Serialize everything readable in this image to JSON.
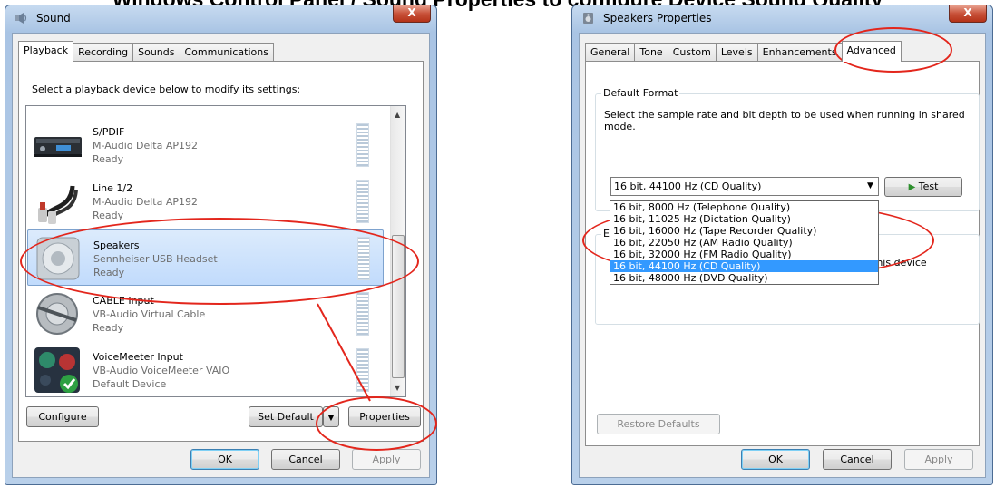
{
  "heading": "Windows Control Panel / Sound Properties to configure Device Sound Quality",
  "sound": {
    "title": "Sound",
    "close_label": "X",
    "tabs": [
      "Playback",
      "Recording",
      "Sounds",
      "Communications"
    ],
    "instruction": "Select a playback device below to modify its settings:",
    "devices": [
      {
        "name": "S/PDIF",
        "desc": "M-Audio Delta AP192",
        "status": "Ready"
      },
      {
        "name": "Line 1/2",
        "desc": "M-Audio Delta AP192",
        "status": "Ready"
      },
      {
        "name": "Speakers",
        "desc": "Sennheiser USB Headset",
        "status": "Ready"
      },
      {
        "name": "CABLE Input",
        "desc": "VB-Audio Virtual Cable",
        "status": "Ready"
      },
      {
        "name": "VoiceMeeter Input",
        "desc": "VB-Audio VoiceMeeter VAIO",
        "status": "Default Device"
      }
    ],
    "configure_label": "Configure",
    "set_default_label": "Set Default",
    "properties_label": "Properties",
    "ok_label": "OK",
    "cancel_label": "Cancel",
    "apply_label": "Apply"
  },
  "speakers": {
    "title": "Speakers Properties",
    "close_label": "X",
    "tabs": [
      "General",
      "Tone",
      "Custom",
      "Levels",
      "Enhancements",
      "Advanced"
    ],
    "default_format_legend": "Default Format",
    "format_description": "Select the sample rate and bit depth to be used when running in shared mode.",
    "selected_format": "16 bit, 44100 Hz (CD Quality)",
    "test_label": "Test",
    "format_options": [
      "16 bit, 8000 Hz (Telephone Quality)",
      "16 bit, 11025 Hz (Dictation Quality)",
      "16 bit, 16000 Hz (Tape Recorder Quality)",
      "16 bit, 22050 Hz (AM Radio Quality)",
      "16 bit, 32000 Hz (FM Radio Quality)",
      "16 bit, 44100 Hz (CD Quality)",
      "16 bit, 48000 Hz (DVD Quality)"
    ],
    "hidden_legend_fragment": "E",
    "hidden_text_fragment": "this device",
    "restore_defaults_label": "Restore Defaults",
    "ok_label": "OK",
    "cancel_label": "Cancel",
    "apply_label": "Apply"
  }
}
